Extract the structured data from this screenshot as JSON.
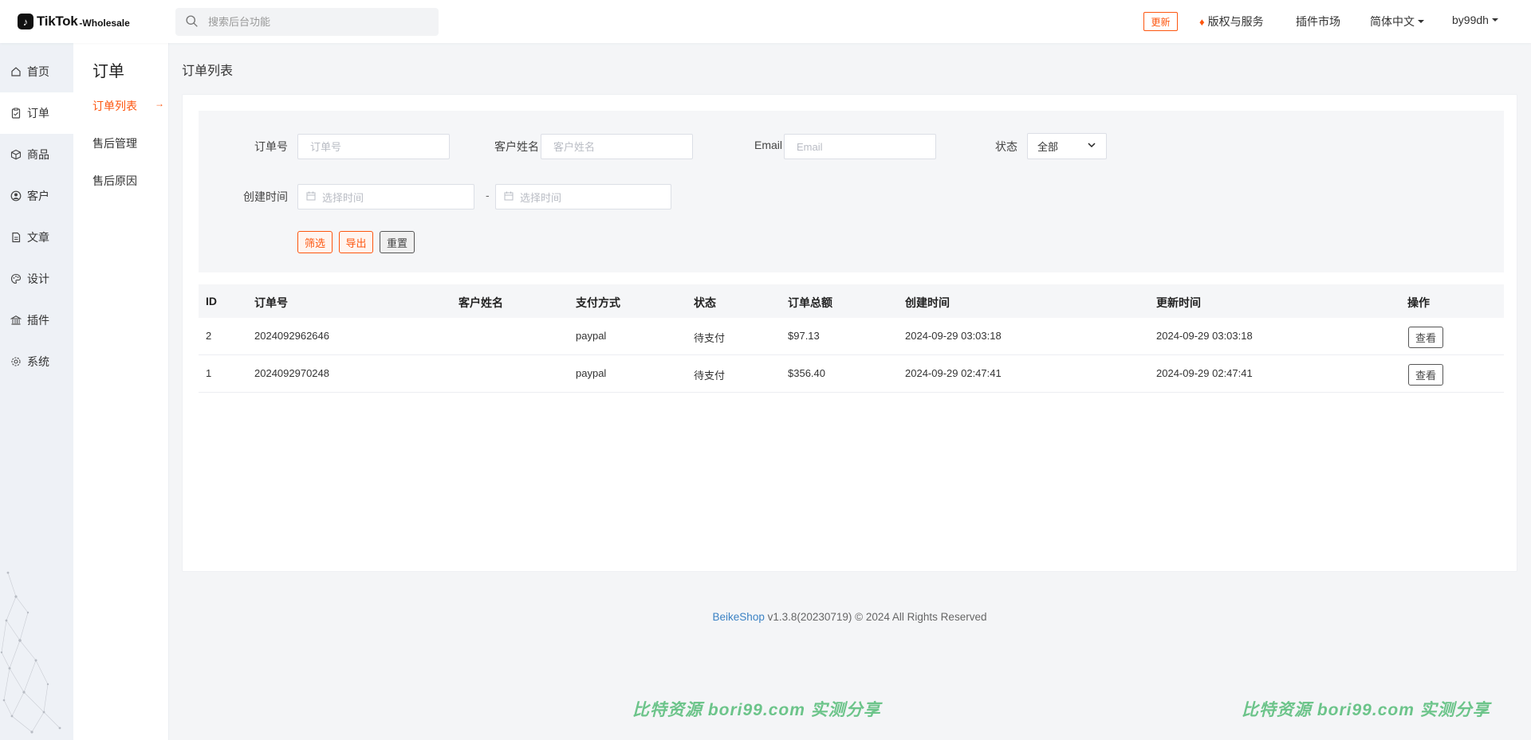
{
  "header": {
    "logo_text": "TikTok",
    "logo_suffix": "-Wholesale",
    "search_placeholder": "搜索后台功能",
    "update_badge": "更新",
    "copyright_link": "版权与服务",
    "plugin_market": "插件市场",
    "language": "简体中文",
    "user": "by99dh"
  },
  "sidebar": {
    "items": [
      {
        "label": "首页",
        "icon": "home-icon"
      },
      {
        "label": "订单",
        "icon": "clipboard-icon"
      },
      {
        "label": "商品",
        "icon": "box-icon"
      },
      {
        "label": "客户",
        "icon": "user-circle-icon"
      },
      {
        "label": "文章",
        "icon": "document-icon"
      },
      {
        "label": "设计",
        "icon": "palette-icon"
      },
      {
        "label": "插件",
        "icon": "building-icon"
      },
      {
        "label": "系统",
        "icon": "gear-icon"
      }
    ]
  },
  "subnav": {
    "title": "订单",
    "items": [
      {
        "label": "订单列表",
        "active": true
      },
      {
        "label": "售后管理"
      },
      {
        "label": "售后原因"
      }
    ],
    "arrow": "→"
  },
  "page": {
    "heading": "订单列表"
  },
  "filters": {
    "order_no_label": "订单号",
    "order_no_placeholder": "订单号",
    "customer_label": "客户姓名",
    "customer_placeholder": "客户姓名",
    "email_label": "Email",
    "email_placeholder": "Email",
    "status_label": "状态",
    "status_value": "全部",
    "created_label": "创建时间",
    "date_placeholder": "选择时间",
    "dash": "-",
    "btn_filter": "筛选",
    "btn_export": "导出",
    "btn_reset": "重置"
  },
  "table": {
    "columns": [
      "ID",
      "订单号",
      "客户姓名",
      "支付方式",
      "状态",
      "订单总额",
      "创建时间",
      "更新时间",
      "操作"
    ],
    "rows": [
      {
        "id": "2",
        "order_no": "2024092962646",
        "customer": "",
        "payment": "paypal",
        "status": "待支付",
        "total": "$97.13",
        "created": "2024-09-29 03:03:18",
        "updated": "2024-09-29 03:03:18",
        "action": "查看"
      },
      {
        "id": "1",
        "order_no": "2024092970248",
        "customer": "",
        "payment": "paypal",
        "status": "待支付",
        "total": "$356.40",
        "created": "2024-09-29 02:47:41",
        "updated": "2024-09-29 02:47:41",
        "action": "查看"
      }
    ]
  },
  "footer": {
    "brand": "BeikeShop",
    "text": " v1.3.8(20230719) © 2024 All Rights Reserved"
  },
  "watermark": {
    "text": "比特资源 bori99.com 实测分享"
  },
  "colors": {
    "accent": "#fd560f",
    "link": "#3b82c4",
    "watermark": "#6cc48a",
    "sidebar_bg": "#eef1f6"
  }
}
